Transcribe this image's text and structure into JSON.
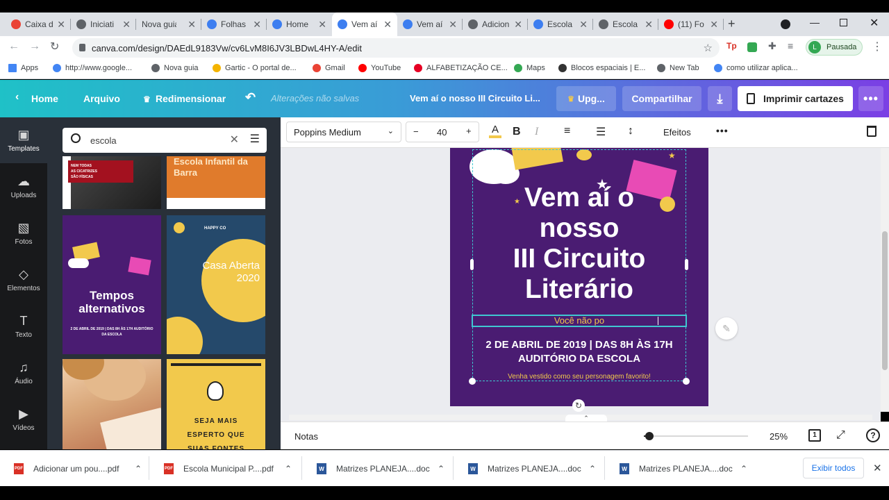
{
  "browser": {
    "tabs": [
      {
        "label": "Caixa d",
        "icon": "gmail-icon",
        "color": "#ea4335"
      },
      {
        "label": "Iniciati",
        "icon": "globe-icon",
        "color": "#5f6368"
      },
      {
        "label": "Nova guia",
        "icon": "none",
        "color": "#dee1e6"
      },
      {
        "label": "Folhas",
        "icon": "canva-icon",
        "color": "#3d7ef0"
      },
      {
        "label": "Home",
        "icon": "canva-icon",
        "color": "#3d7ef0"
      },
      {
        "label": "Vem aí",
        "icon": "canva-icon",
        "color": "#3d7ef0"
      },
      {
        "label": "Vem aí",
        "icon": "canva-icon",
        "color": "#3d7ef0"
      },
      {
        "label": "Adicion",
        "icon": "globe-icon",
        "color": "#5f6368"
      },
      {
        "label": "Escola",
        "icon": "canva-icon",
        "color": "#3d7ef0"
      },
      {
        "label": "Escola",
        "icon": "globe-icon",
        "color": "#5f6368"
      },
      {
        "label": "(11) Fo",
        "icon": "youtube-icon",
        "color": "#ff0000"
      }
    ],
    "url": "canva.com/design/DAEdL9183Vw/cv6LvM8I6JV3LBDwL4HY-A/edit",
    "profile_letter": "L",
    "profile_status": "Pausada",
    "bookmarks": [
      {
        "label": "Apps",
        "color": "#4285f4"
      },
      {
        "label": "http://www.google...",
        "color": "#4285f4"
      },
      {
        "label": "Nova guia",
        "color": "#5f6368"
      },
      {
        "label": "Gartic - O portal de...",
        "color": "#f4b400"
      },
      {
        "label": "Gmail",
        "color": "#ea4335"
      },
      {
        "label": "YouTube",
        "color": "#ff0000"
      },
      {
        "label": "ALFABETIZAÇÃO CE...",
        "color": "#e60023"
      },
      {
        "label": "Maps",
        "color": "#34a853"
      },
      {
        "label": "Blocos espaciais | E...",
        "color": "#333333"
      },
      {
        "label": "New Tab",
        "color": "#5f6368"
      },
      {
        "label": "como utilizar aplica...",
        "color": "#4285f4"
      }
    ]
  },
  "header": {
    "home": "Home",
    "arquivo": "Arquivo",
    "redimensionar": "Redimensionar",
    "unsaved": "Alterações não salvas",
    "doc_title": "Vem aí o nosso III Circuito Li...",
    "upgrade": "Upg...",
    "share": "Compartilhar",
    "print": "Imprimir cartazes"
  },
  "rail": [
    {
      "label": "Templates",
      "icon": "templates-icon",
      "glyph": "▣"
    },
    {
      "label": "Uploads",
      "icon": "cloud-upload-icon",
      "glyph": "☁"
    },
    {
      "label": "Fotos",
      "icon": "image-icon",
      "glyph": "▧"
    },
    {
      "label": "Elementos",
      "icon": "shapes-icon",
      "glyph": "◇"
    },
    {
      "label": "Texto",
      "icon": "text-icon",
      "glyph": "T"
    },
    {
      "label": "Áudio",
      "icon": "music-icon",
      "glyph": "♫"
    },
    {
      "label": "Vídeos",
      "icon": "video-icon",
      "glyph": "▶"
    }
  ],
  "search": {
    "value": "escola"
  },
  "templates": {
    "t1_line1": "NEM TODAS",
    "t1_line2": "AS CICATRIZES",
    "t1_line3": "SÃO FÍSICAS",
    "t2_title": "Escola Infantil da Barra",
    "t3_title": "Tempos alternativos",
    "t3_date": "2 DE ABRIL DE 2019 | DAS 8H ÀS 17H AUDITÓRIO DA ESCOLA",
    "t4_brand": "HAPPY CO",
    "t4_title": "Casa Aberta 2020",
    "t6_text": "SEJA MAIS ESPERTO QUE SUAS FONTES"
  },
  "toolbar": {
    "font": "Poppins Medium",
    "size": "40",
    "effects": "Efeitos",
    "text_color": "#f2c94c"
  },
  "poster": {
    "title_l1": "Vem aí o",
    "title_l2": "nosso",
    "title_l3": "III Circuito",
    "title_l4": "Literário",
    "editing": "Você não po",
    "date_l1": "2 DE ABRIL DE 2019 | DAS 8H ÀS 17H",
    "date_l2": "AUDITÓRIO DA ESCOLA",
    "note": "Venha vestido como seu personagem favorito!",
    "bg": "#4a1c72",
    "accent": "#f2c94c"
  },
  "footer": {
    "notes": "Notas",
    "zoom": "25%",
    "pages": "1",
    "zoom_fraction": 0.25
  },
  "downloads": {
    "items": [
      {
        "label": "Adicionar um pou....pdf",
        "type": "PDF"
      },
      {
        "label": "Escola Municipal P....pdf",
        "type": "PDF"
      },
      {
        "label": "Matrizes PLANEJA....doc",
        "type": "W"
      },
      {
        "label": "Matrizes PLANEJA....doc",
        "type": "W"
      },
      {
        "label": "Matrizes PLANEJA....doc",
        "type": "W"
      }
    ],
    "show_all": "Exibir todos"
  }
}
